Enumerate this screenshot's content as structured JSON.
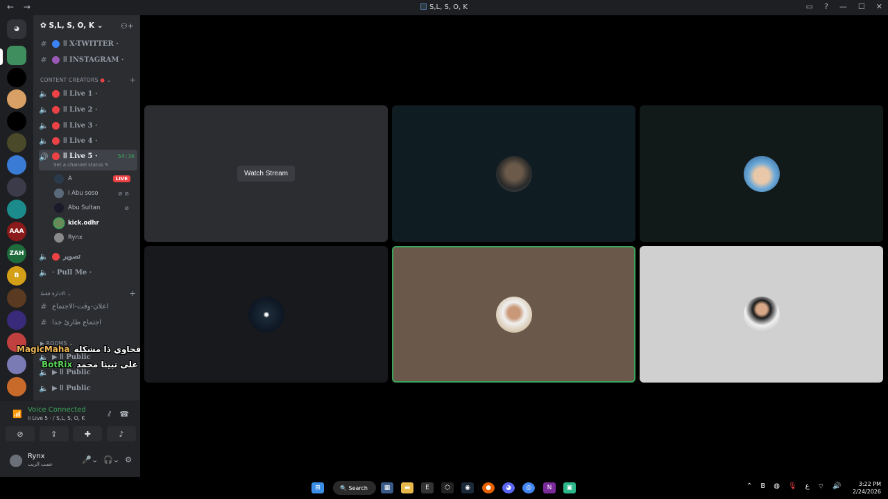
{
  "window": {
    "title": "S,L, S, O, K",
    "back": "←",
    "forward": "→",
    "controls": [
      "▭",
      "?",
      "—",
      "☐",
      "✕"
    ]
  },
  "server": {
    "name": "S,L, S, O, K",
    "add_member_icon": "person-add-icon"
  },
  "servers": [
    {
      "label": "",
      "color": "#2b2d31"
    },
    {
      "label": "",
      "color": "#3e8e5e"
    },
    {
      "label": "",
      "color": "#000000"
    },
    {
      "label": "",
      "color": "#d9a066"
    },
    {
      "label": "",
      "color": "#000000"
    },
    {
      "label": "",
      "color": "#4a4a2a"
    },
    {
      "label": "",
      "color": "#3a7bd5"
    },
    {
      "label": "",
      "color": "#3b3b4a"
    },
    {
      "label": "",
      "color": "#1c8b8b"
    },
    {
      "label": "AAA",
      "color": "#8b1a1a"
    },
    {
      "label": "ZAH",
      "color": "#1e6b3b"
    },
    {
      "label": "B",
      "color": "#d4a017"
    },
    {
      "label": "",
      "color": "#5a3a20"
    },
    {
      "label": "",
      "color": "#3a2a7a"
    },
    {
      "label": "",
      "color": "#c04040"
    },
    {
      "label": "",
      "color": "#7a7ab5"
    },
    {
      "label": "",
      "color": "#c86a2a"
    }
  ],
  "channels_top": [
    {
      "sym": "#",
      "name": "اا X-TWITTER ·",
      "dot": "#3b82f6"
    },
    {
      "sym": "#",
      "name": "اا INSTAGRAM ·",
      "dot": "#9b59b6"
    }
  ],
  "category_creators": "CONTENT CREATORS",
  "voice_channels": [
    {
      "name": "اا Live 1 ·"
    },
    {
      "name": "اا Live 2 ·"
    },
    {
      "name": "اا Live 3 ·"
    },
    {
      "name": "اا Live 4 ·"
    }
  ],
  "active_channel": {
    "name": "اا Live 5 ·",
    "time": "54:36",
    "status": "Set a channel status"
  },
  "voice_users": [
    {
      "name": "A",
      "badge": "LIVE",
      "avatar": "#2a3a4a"
    },
    {
      "name": "ا Abu soso",
      "badge": "",
      "avatar": "#5a6a7a"
    },
    {
      "name": "Abu Sultan",
      "badge": "",
      "avatar": "#1a1a2a"
    },
    {
      "name": "kick.odhr",
      "badge": "",
      "avatar": "#6a8a5a"
    },
    {
      "name": "Rynx",
      "badge": "",
      "avatar": "#8a8a8a"
    }
  ],
  "other_voice": [
    {
      "name": "تصوير"
    },
    {
      "name": "· Pull Me ·"
    }
  ],
  "category_admin": "الادارة فقط",
  "admin_channels": [
    {
      "name": "اعلان-وقت-الاجتماع"
    },
    {
      "name": "اجتماع طارئ جدا"
    }
  ],
  "category_rooms": "ROOMS",
  "rooms": [
    {
      "name": "▶ اا Public"
    },
    {
      "name": "▶ اا Public"
    },
    {
      "name": "▶ اا Public"
    }
  ],
  "chat_overlay": [
    {
      "nick": "MagicMaha",
      "nick_color": "#f0b95a",
      "text": "ياخي الرقحاوي ذا مشكله"
    },
    {
      "nick": "BotRix",
      "nick_color": "#5cd65c",
      "text": "صل على نبينا محمد"
    }
  ],
  "voice_panel": {
    "title": "Voice Connected",
    "subtitle": "اا Live 5 · / S,L, S, O, K"
  },
  "user_panel": {
    "name": "Rynx",
    "status": "عصب الريب"
  },
  "stage": {
    "watch_label": "Watch Stream",
    "tiles": [
      {
        "bg": "#2b2d31",
        "type": "watch"
      },
      {
        "bg": "#0f1c22",
        "avatar": "#3b4a55"
      },
      {
        "bg": "#111a18",
        "avatar": "#6aa8d8"
      },
      {
        "bg": "#18191c",
        "avatar": "#1c2a38"
      },
      {
        "bg": "#6a584a",
        "avatar": "#c8b8a0",
        "speaking": true
      },
      {
        "bg": "#d0d0d0",
        "avatar": "#f0f0f0"
      }
    ]
  },
  "taskbar": {
    "search": "Search",
    "apps": [
      "windows",
      "widgets",
      "files",
      "epic",
      "unity",
      "steam",
      "firefox",
      "discord",
      "chrome",
      "next",
      "green-app"
    ],
    "time": "3:22 PM",
    "date": "2/24/2026",
    "lang": "ع"
  }
}
